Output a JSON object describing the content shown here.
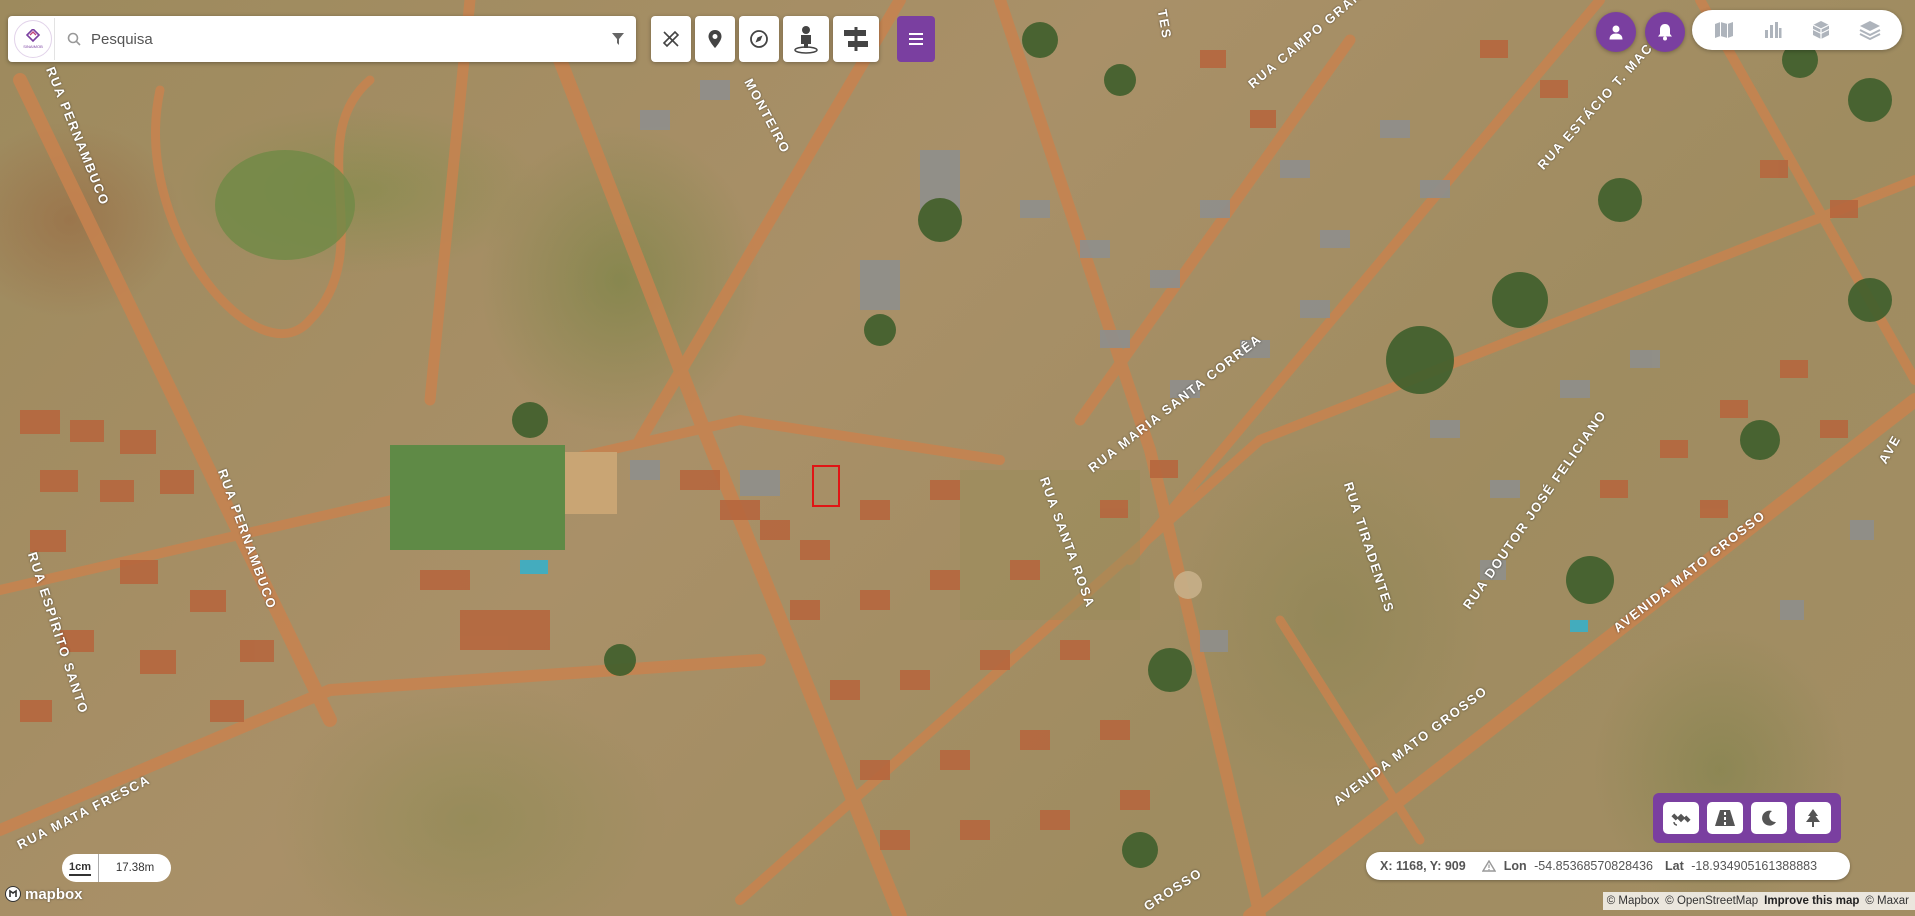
{
  "app": {
    "logo_text": "SINAIMOB",
    "brand_color": "#7a3fa0"
  },
  "search": {
    "placeholder": "Pesquisa",
    "icon": "search-icon",
    "filter_icon": "filter-icon"
  },
  "toolbar": {
    "tools": [
      {
        "name": "measure-tool",
        "icon": "ruler-pencil-icon"
      },
      {
        "name": "marker-tool",
        "icon": "map-pin-icon"
      },
      {
        "name": "compass-tool",
        "icon": "compass-icon"
      },
      {
        "name": "street-view-tool",
        "icon": "pegman-icon"
      },
      {
        "name": "compare-tool",
        "icon": "swipe-compare-icon"
      }
    ],
    "menu_icon": "hamburger-menu-icon"
  },
  "top_right": {
    "user_icon": "user-icon",
    "notification_icon": "bell-icon",
    "layers": [
      "map-icon",
      "bar-chart-icon",
      "cube-icon",
      "layers-icon"
    ]
  },
  "map_styles": [
    "satellite-icon",
    "road-icon",
    "night-mode-icon",
    "tree-icon"
  ],
  "streets": [
    "RUA PERNAMBUCO",
    "RUA PERNAMBUCO",
    "RUA ESPÍRITO SANTO",
    "RUA MATA FRESCA",
    "MONTEIRO",
    "RUA CAMPO GRANDE",
    "RUA ESTÁCIO T. MACIEL",
    "RUA MARIA SANTA CORRÊA",
    "RUA SANTA ROSA",
    "RUA TIRADENTES",
    "RUA DOUTOR JOSÉ FELICIANO",
    "AVENIDA MATO GROSSO",
    "AVENIDA MATO GROSSO",
    "GROSSO",
    "AVE",
    "TES"
  ],
  "coordinates": {
    "xy": "X: 1168, Y: 909",
    "lon_label": "Lon",
    "lon_value": "-54.85368570828436",
    "lat_label": "Lat",
    "lat_value": "-18.934905161388883"
  },
  "scale": {
    "unit": "1cm",
    "value": "17.38m"
  },
  "attribution": {
    "mapbox_logo": "mapbox",
    "mapbox": "© Mapbox",
    "osm": "© OpenStreetMap",
    "improve": "Improve this map",
    "maxar": "© Maxar"
  }
}
